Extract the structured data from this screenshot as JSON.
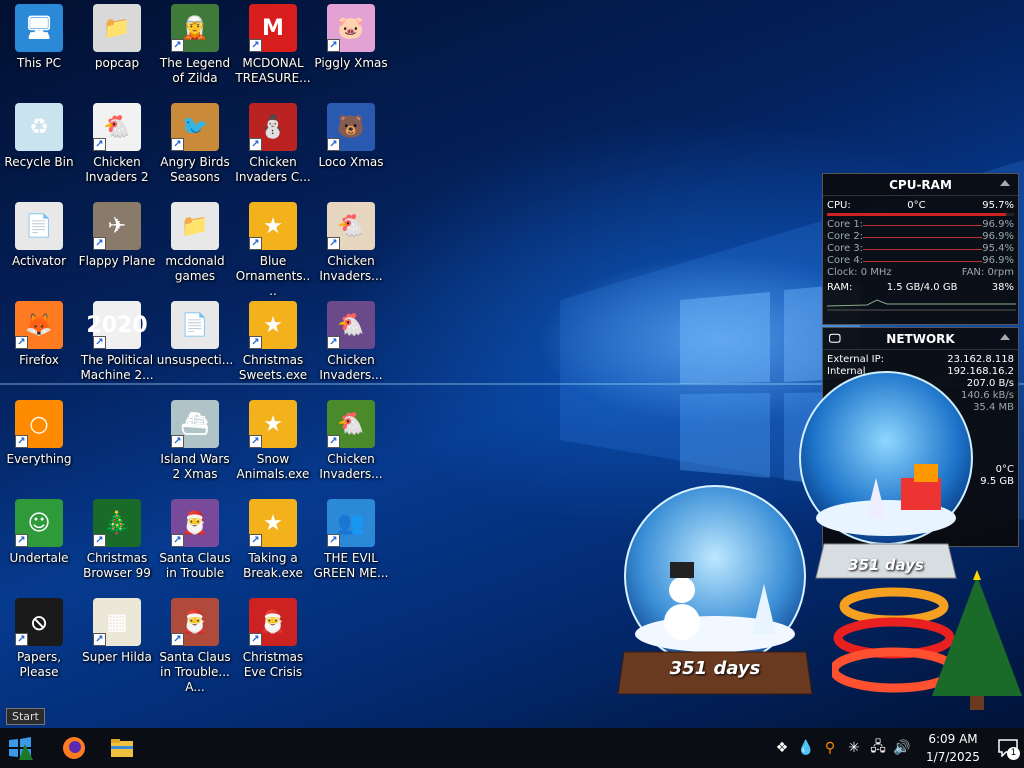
{
  "desktop_icons": [
    {
      "label": "This PC",
      "glyph": "🖥",
      "color": "#2a8ad8",
      "shortcut": false
    },
    {
      "label": "popcap",
      "glyph": "📁",
      "color": "#d9d9d9",
      "shortcut": false
    },
    {
      "label": "The Legend of Zilda",
      "glyph": "🧝",
      "color": "#3f7a3a",
      "shortcut": true
    },
    {
      "label": "MCDONAL TREASURE...",
      "glyph": "M",
      "color": "#d81d1d",
      "shortcut": true
    },
    {
      "label": "Piggly Xmas",
      "glyph": "🐷",
      "color": "#e3a2d4",
      "shortcut": true
    },
    {
      "label": "Recycle Bin",
      "glyph": "♻",
      "color": "#c9e4ef",
      "shortcut": false
    },
    {
      "label": "Chicken Invaders 2",
      "glyph": "🐔",
      "color": "#f2f2f2",
      "shortcut": true
    },
    {
      "label": "Angry Birds Seasons",
      "glyph": "🐦",
      "color": "#c98a3a",
      "shortcut": true
    },
    {
      "label": "Chicken Invaders C...",
      "glyph": "⛄",
      "color": "#b22",
      "shortcut": true
    },
    {
      "label": "Loco Xmas",
      "glyph": "🐻",
      "color": "#2a5ab0",
      "shortcut": true
    },
    {
      "label": "Activator",
      "glyph": "📄",
      "color": "#e8e8e8",
      "shortcut": false
    },
    {
      "label": "Flappy Plane",
      "glyph": "✈",
      "color": "#8a7a6a",
      "shortcut": true
    },
    {
      "label": "mcdonald games",
      "glyph": "📁",
      "color": "#e8e8e8",
      "shortcut": false
    },
    {
      "label": "Blue Ornaments....",
      "glyph": "★",
      "color": "#f3b21c",
      "shortcut": true
    },
    {
      "label": "Chicken Invaders...",
      "glyph": "🐔",
      "color": "#e6d6c0",
      "shortcut": true
    },
    {
      "label": "Firefox",
      "glyph": "🦊",
      "color": "#ff7b22",
      "shortcut": true
    },
    {
      "label": "The Political Machine 2...",
      "glyph": "2020",
      "color": "#f0f0f0",
      "shortcut": true
    },
    {
      "label": "unsuspecti...",
      "glyph": "📄",
      "color": "#e8e8e8",
      "shortcut": false
    },
    {
      "label": "Christmas Sweets.exe",
      "glyph": "★",
      "color": "#f3b21c",
      "shortcut": true
    },
    {
      "label": "Chicken Invaders...",
      "glyph": "🐔",
      "color": "#6a4a8a",
      "shortcut": true
    },
    {
      "label": "Everything",
      "glyph": "○",
      "color": "#ff8c00",
      "shortcut": true
    },
    {
      "label": "Island Wars 2 Xmas",
      "glyph": "⛴",
      "color": "#b0c4c8",
      "shortcut": true
    },
    {
      "label": "Snow Animals.exe",
      "glyph": "★",
      "color": "#f3b21c",
      "shortcut": true
    },
    {
      "label": "Chicken Invaders...",
      "glyph": "🐔",
      "color": "#4a8a2a",
      "shortcut": true
    },
    {
      "label": "Undertale",
      "glyph": "☺",
      "color": "#2f9a3a",
      "shortcut": true
    },
    {
      "label": "Christmas Browser 99",
      "glyph": "🎄",
      "color": "#1a6a2a",
      "shortcut": true
    },
    {
      "label": "Santa Claus in Trouble",
      "glyph": "🎅",
      "color": "#7a4a9a",
      "shortcut": true
    },
    {
      "label": "Taking a Break.exe",
      "glyph": "★",
      "color": "#f3b21c",
      "shortcut": true
    },
    {
      "label": "THE EVIL GREEN ME...",
      "glyph": "👥",
      "color": "#2a8ad8",
      "shortcut": true
    },
    {
      "label": "Papers, Please",
      "glyph": "⦸",
      "color": "#1a1a1a",
      "shortcut": true
    },
    {
      "label": "Super Hilda",
      "glyph": "▦",
      "color": "#ece8d8",
      "shortcut": true
    },
    {
      "label": "Santa Claus in Trouble... A...",
      "glyph": "🎅",
      "color": "#b04a3a",
      "shortcut": true
    },
    {
      "label": "Christmas Eve Crisis",
      "glyph": "🎅",
      "color": "#cc2222",
      "shortcut": true
    }
  ],
  "cpu_ram": {
    "title": "CPU-RAM",
    "cpu_label": "CPU:",
    "cpu_temp": "0°C",
    "cpu_pct": "95.7%",
    "cores": [
      {
        "label": "Core 1:",
        "pct": "96.9%"
      },
      {
        "label": "Core 2:",
        "pct": "96.9%"
      },
      {
        "label": "Core 3:",
        "pct": "95.4%"
      },
      {
        "label": "Core 4:",
        "pct": "96.9%"
      }
    ],
    "clock": "Clock: 0 MHz",
    "fan": "FAN: 0rpm",
    "ram_label": "RAM:",
    "ram_val": "1.5 GB/4.0 GB",
    "ram_pct": "38%"
  },
  "network": {
    "title": "NETWORK",
    "external_label": "External IP:",
    "external_ip": "23.162.8.118",
    "internal_label": "Internal",
    "internal_ip": "192.168.16.2",
    "speed": "207.0 B/s",
    "speed2": "140.6 kB/s",
    "mem": "35.4 MB",
    "temp": "0°C",
    "size": "9.5 GB"
  },
  "globes": {
    "left_days": "351 days",
    "right_days": "351 days"
  },
  "start_tooltip": "Start",
  "tray": {
    "time": "6:09 AM",
    "date": "1/7/2025",
    "notification_count": "1"
  }
}
